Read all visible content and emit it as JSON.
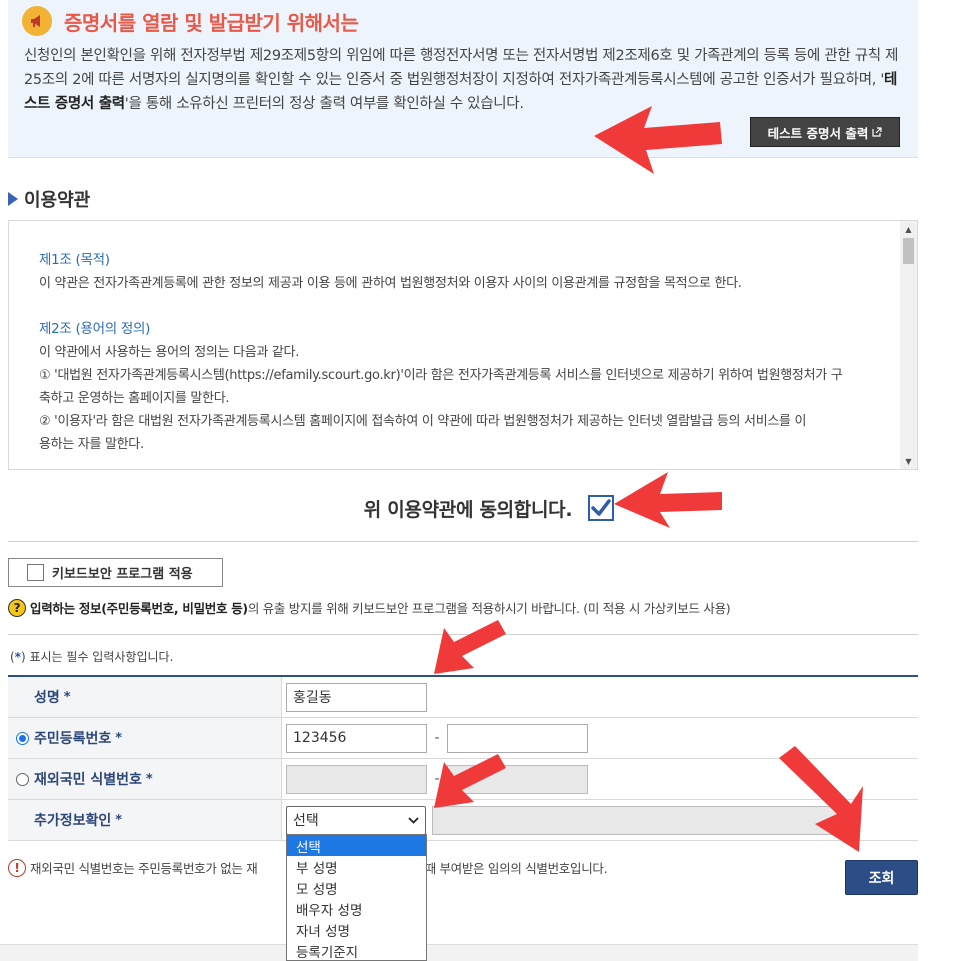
{
  "notice": {
    "title": "증명서를 열람 및 발급받기 위해서는",
    "body_prefix": "신청인의 본인확인을 위해 전자정부법 제29조제5항의 위임에 따른 행정전자서명 또는 전자서명법 제2조제6호 및 가족관계의 등록 등에 관한 규칙 제25조의 2에 따른 서명자의 실지명의를 확인할 수 있는 인증서 중 법원행정처장이 지정하여 전자가족관계등록시스템에 공고한 인증서가 필요하며, '",
    "body_bold": "테스트 증명서 출력",
    "body_suffix": "'을 통해 소유하신 프린터의 정상 출력 여부를 확인하실 수 있습니다.",
    "test_button": "테스트 증명서 출력",
    "icon": "megaphone-icon"
  },
  "terms": {
    "section_title": "이용약관",
    "lines": [
      {
        "type": "art",
        "text": "제1조 (목적)"
      },
      {
        "type": "text",
        "text": "이 약관은 전자가족관계등록에 관한 정보의 제공과 이용 등에 관하여 법원행정처와 이용자 사이의 이용관계를 규정함을 목적으로 한다."
      },
      {
        "type": "gap",
        "text": ""
      },
      {
        "type": "art",
        "text": "제2조 (용어의 정의)"
      },
      {
        "type": "text",
        "text": "이 약관에서 사용하는 용어의 정의는 다음과 같다."
      },
      {
        "type": "text",
        "text": "① '대법원 전자가족관계등록시스템(https://efamily.scourt.go.kr)'이라 함은 전자가족관계등록 서비스를 인터넷으로 제공하기 위하여 법원행정처가 구"
      },
      {
        "type": "text",
        "text": "축하고 운영하는 홈페이지를 말한다."
      },
      {
        "type": "text",
        "text": "② '이용자'라 함은 대법원 전자가족관계등록시스템 홈페이지에 접속하여 이 약관에 따라 법원행정처가 제공하는 인터넷 열람발급 등의 서비스를 이"
      },
      {
        "type": "text",
        "text": "용하는 자를 말한다."
      }
    ],
    "agree_text": "위 이용약관에 동의합니다.",
    "agree_checked": true
  },
  "security": {
    "keyboard_button": "키보드보안 프로그램 적용",
    "note_bold": "입력하는 정보(주민등록번호, 비밀번호 등)",
    "note_rest": "의 유출 방지를 위해 키보드보안 프로그램을 적용하시기 바랍니다. (미 적용 시 가상키보드 사용)"
  },
  "form": {
    "required_note_prefix": "(",
    "required_note_star": "*",
    "required_note_suffix": ") 표시는 필수 입력사항입니다.",
    "star": "*",
    "name_label": "성명",
    "name_value": "홍길동",
    "rrn_label": "주민등록번호",
    "rrn_front": "123456",
    "rrn_back": "",
    "foreign_label": "재외국민 식별번호",
    "dash": "-",
    "extra_label": "추가정보확인",
    "extra_selected": "선택",
    "extra_options": [
      "선택",
      "부 성명",
      "모 성명",
      "배우자 성명",
      "자녀 성명",
      "등록기준지"
    ]
  },
  "footer": {
    "footnote_prefix": "재외국민 식별번호는 주민등록번호가 없는 재",
    "footnote_suffix": "받을 때 부여받은 임의의 식별번호입니다.",
    "search_button": "조회"
  },
  "colors": {
    "title_red": "#e8594a",
    "navy": "#2c4d86",
    "accent_blue": "#2f5da8",
    "arrow_red": "#f03a3a"
  }
}
